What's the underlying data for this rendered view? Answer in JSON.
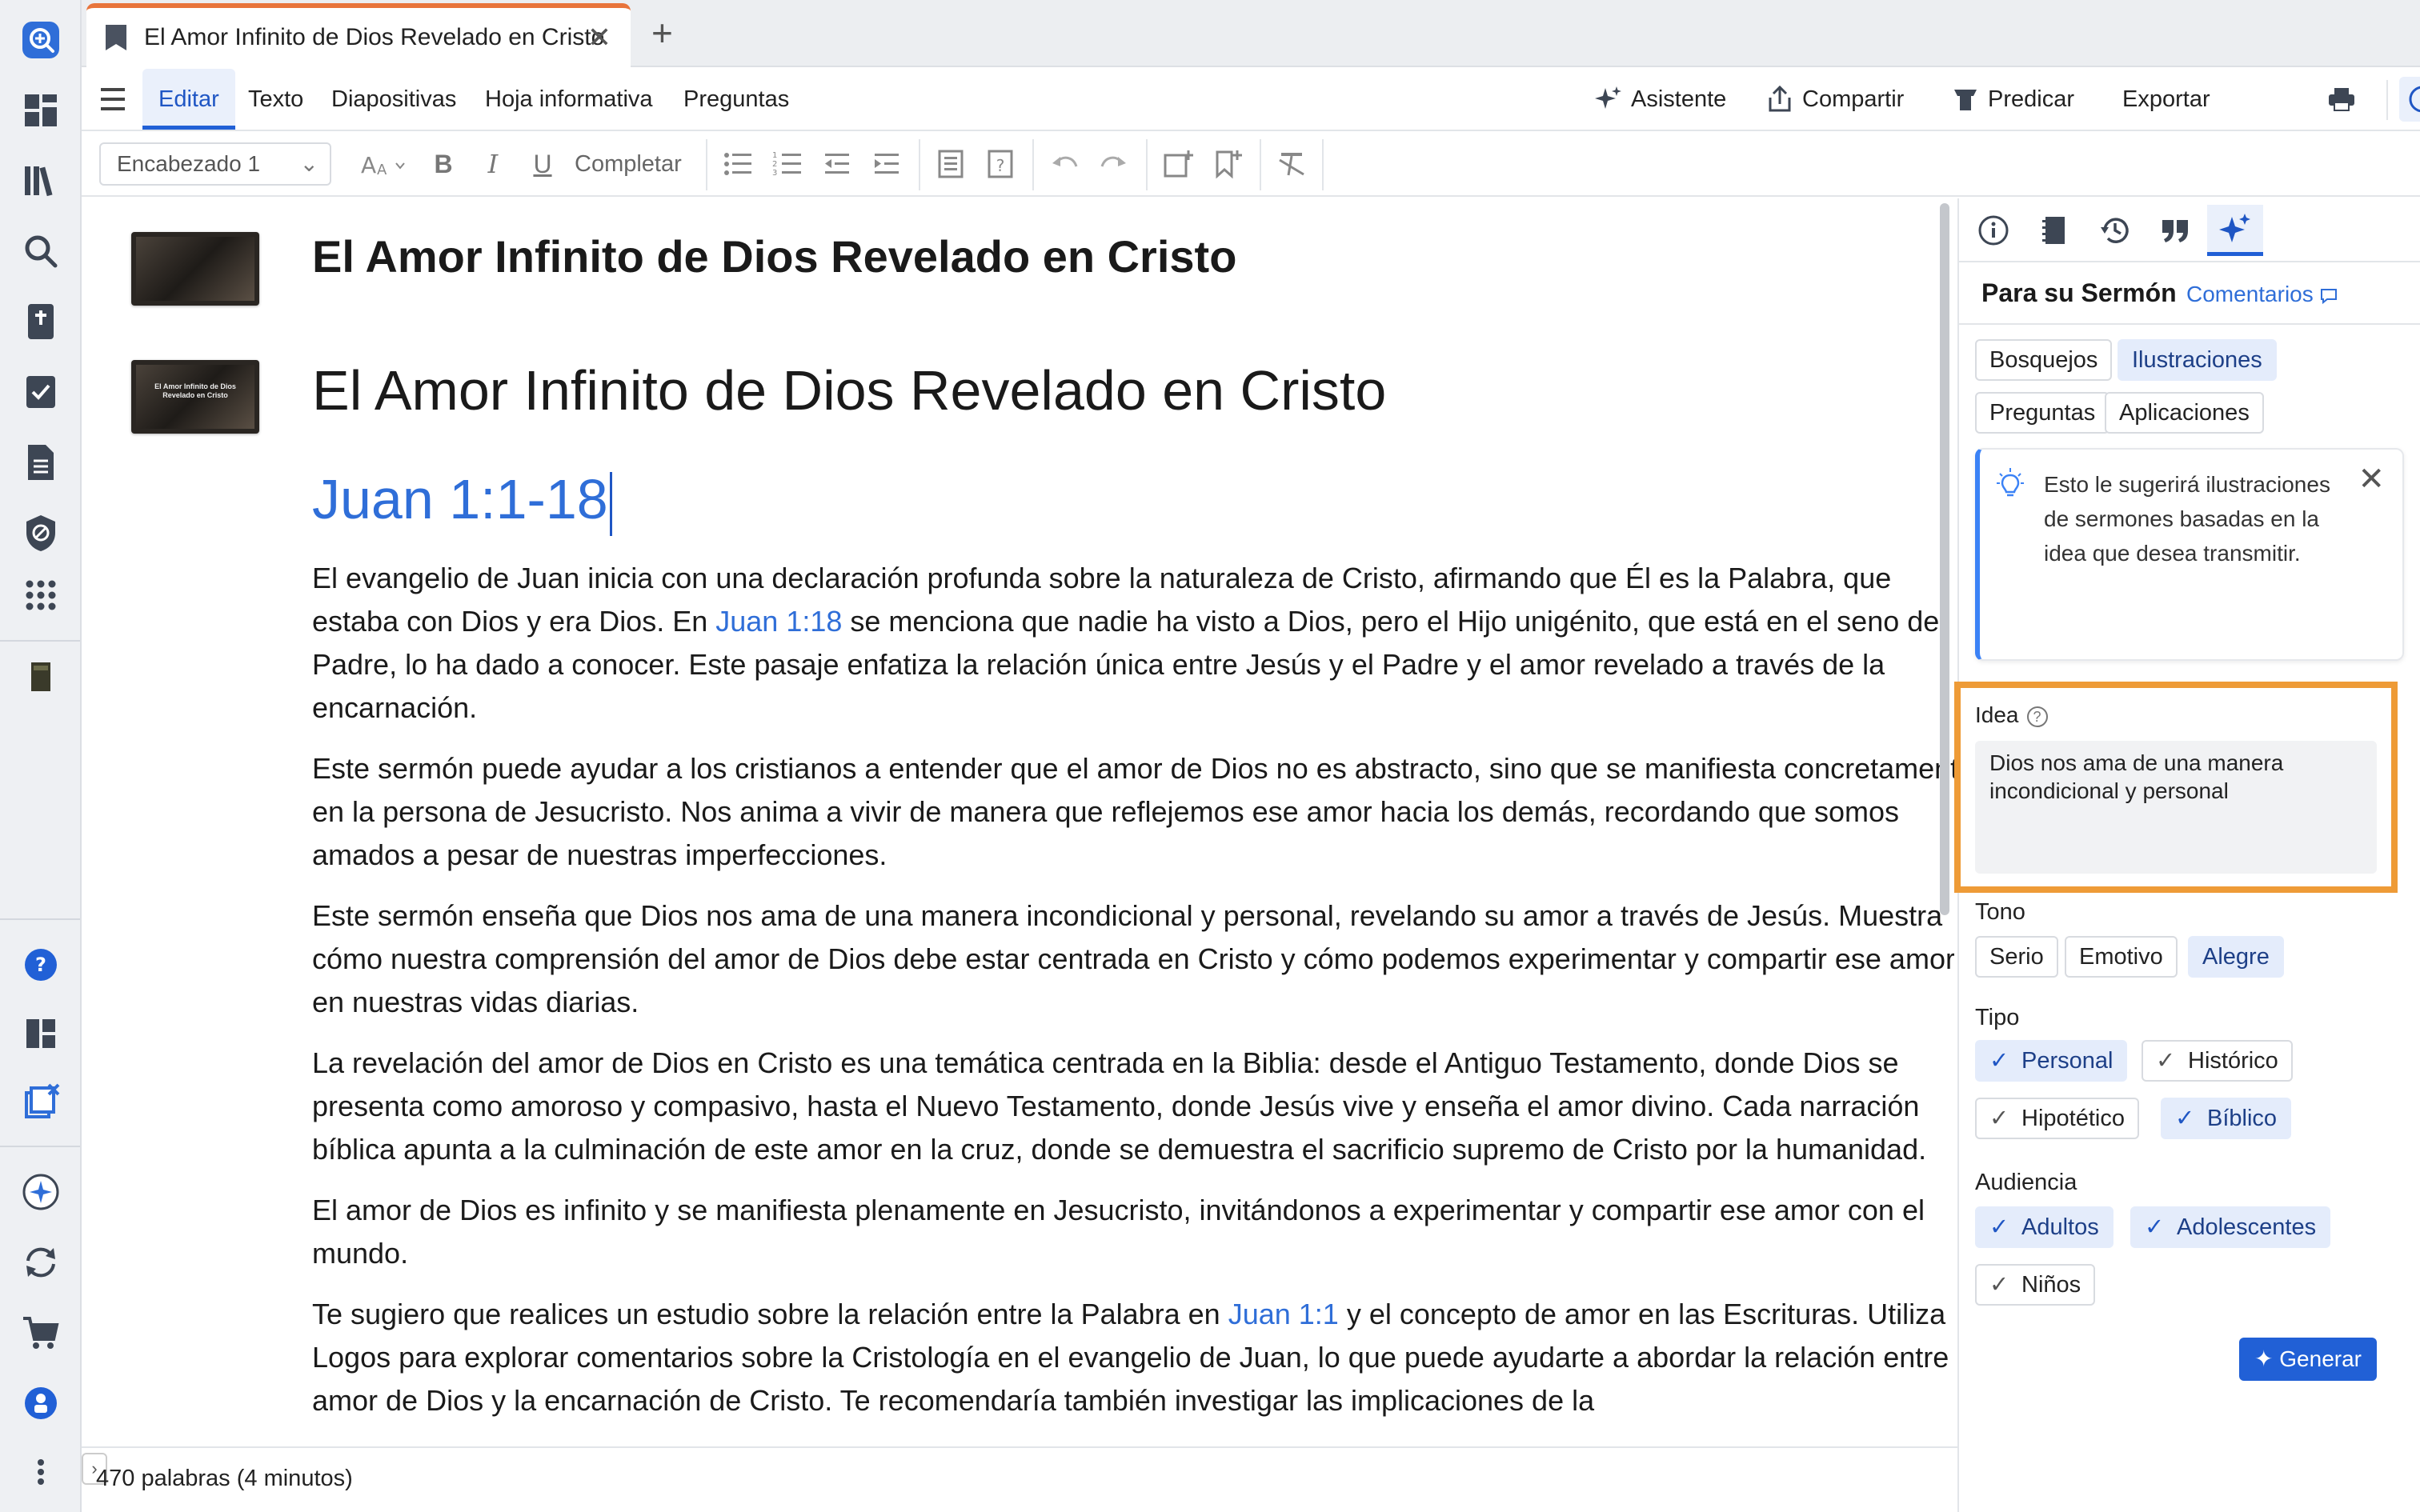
{
  "tab": {
    "title": "El Amor Infinito de Dios Revelado en Cristo",
    "close": "✕",
    "new": "+"
  },
  "menu": {
    "items": [
      "Editar",
      "Texto",
      "Diapositivas",
      "Hoja informativa",
      "Preguntas"
    ],
    "assistant": "Asistente",
    "share": "Compartir",
    "preach": "Predicar",
    "export": "Exportar"
  },
  "toolbar": {
    "style": "Encabezado 1",
    "complete": "Completar"
  },
  "document": {
    "title": "El Amor Infinito de Dios Revelado en Cristo",
    "heading": "El Amor Infinito de Dios Revelado en Cristo",
    "reference": "Juan 1:1-18",
    "thumb_text": "El Amor Infinito de Dios Revelado en Cristo",
    "p1a": "El evangelio de Juan inicia con una declaración profunda sobre la naturaleza de Cristo, afirmando que Él es la Palabra, que estaba con Dios y era Dios. En ",
    "p1_link": "Juan 1:18",
    "p1b": " se menciona que nadie ha visto a Dios, pero el Hijo unigénito, que está en el seno del Padre, lo ha dado a conocer. Este pasaje enfatiza la relación única entre Jesús y el Padre y el amor revelado a través de la encarnación.",
    "p2": "Este sermón puede ayudar a los cristianos a entender que el amor de Dios no es abstracto, sino que se manifiesta concretamente en la persona de Jesucristo. Nos anima a vivir de manera que reflejemos ese amor hacia los demás, recordando que somos amados a pesar de nuestras imperfecciones.",
    "p3": "Este sermón enseña que Dios nos ama de una manera incondicional y personal, revelando su amor a través de Jesús. Muestra cómo nuestra comprensión del amor de Dios debe estar centrada en Cristo y cómo podemos experimentar y compartir ese amor en nuestras vidas diarias.",
    "p4": "La revelación del amor de Dios en Cristo es una temática centrada en la Biblia: desde el Antiguo Testamento, donde Dios se presenta como amoroso y compasivo, hasta el Nuevo Testamento, donde Jesús vive y enseña el amor divino. Cada narración bíblica apunta a la culminación de este amor en la cruz, donde se demuestra el sacrificio supremo de Cristo por la humanidad.",
    "p5": "El amor de Dios es infinito y se manifiesta plenamente en Jesucristo, invitándonos a experimentar y compartir ese amor con el mundo.",
    "p6a": "Te sugiero que realices un estudio sobre la relación entre la Palabra en ",
    "p6_link": "Juan 1:1",
    "p6b": " y el concepto de amor en las Escrituras. Utiliza Logos para explorar comentarios sobre la Cristología en el evangelio de Juan, lo que puede ayudarte a abordar la relación entre el amor de Dios y la encarnación de Cristo. Te recomendaría también investigar las implicaciones de la"
  },
  "status": {
    "words": "470 palabras (4 minutos)",
    "toggle": "›"
  },
  "panel": {
    "title": "Para su Sermón",
    "comments": "Comentarios",
    "categories": [
      "Bosquejos",
      "Ilustraciones",
      "Preguntas",
      "Aplicaciones"
    ],
    "hint": "Esto le sugerirá ilustraciones de sermones basadas en la idea que desea transmitir.",
    "hint_close": "✕",
    "idea_label": "Idea",
    "idea_value": "Dios nos ama de una manera incondicional y personal",
    "tone_label": "Tono",
    "tones": [
      "Serio",
      "Emotivo",
      "Alegre"
    ],
    "type_label": "Tipo",
    "types": [
      "Personal",
      "Histórico",
      "Hipotético",
      "Bíblico"
    ],
    "audience_label": "Audiencia",
    "audiences": [
      "Adultos",
      "Adolescentes",
      "Niños"
    ],
    "generate": "Generar"
  },
  "colors": {
    "accent": "#2160d6",
    "tab_accent": "#e8743b",
    "highlight": "#ee9b37",
    "link": "#2f6ed8"
  }
}
